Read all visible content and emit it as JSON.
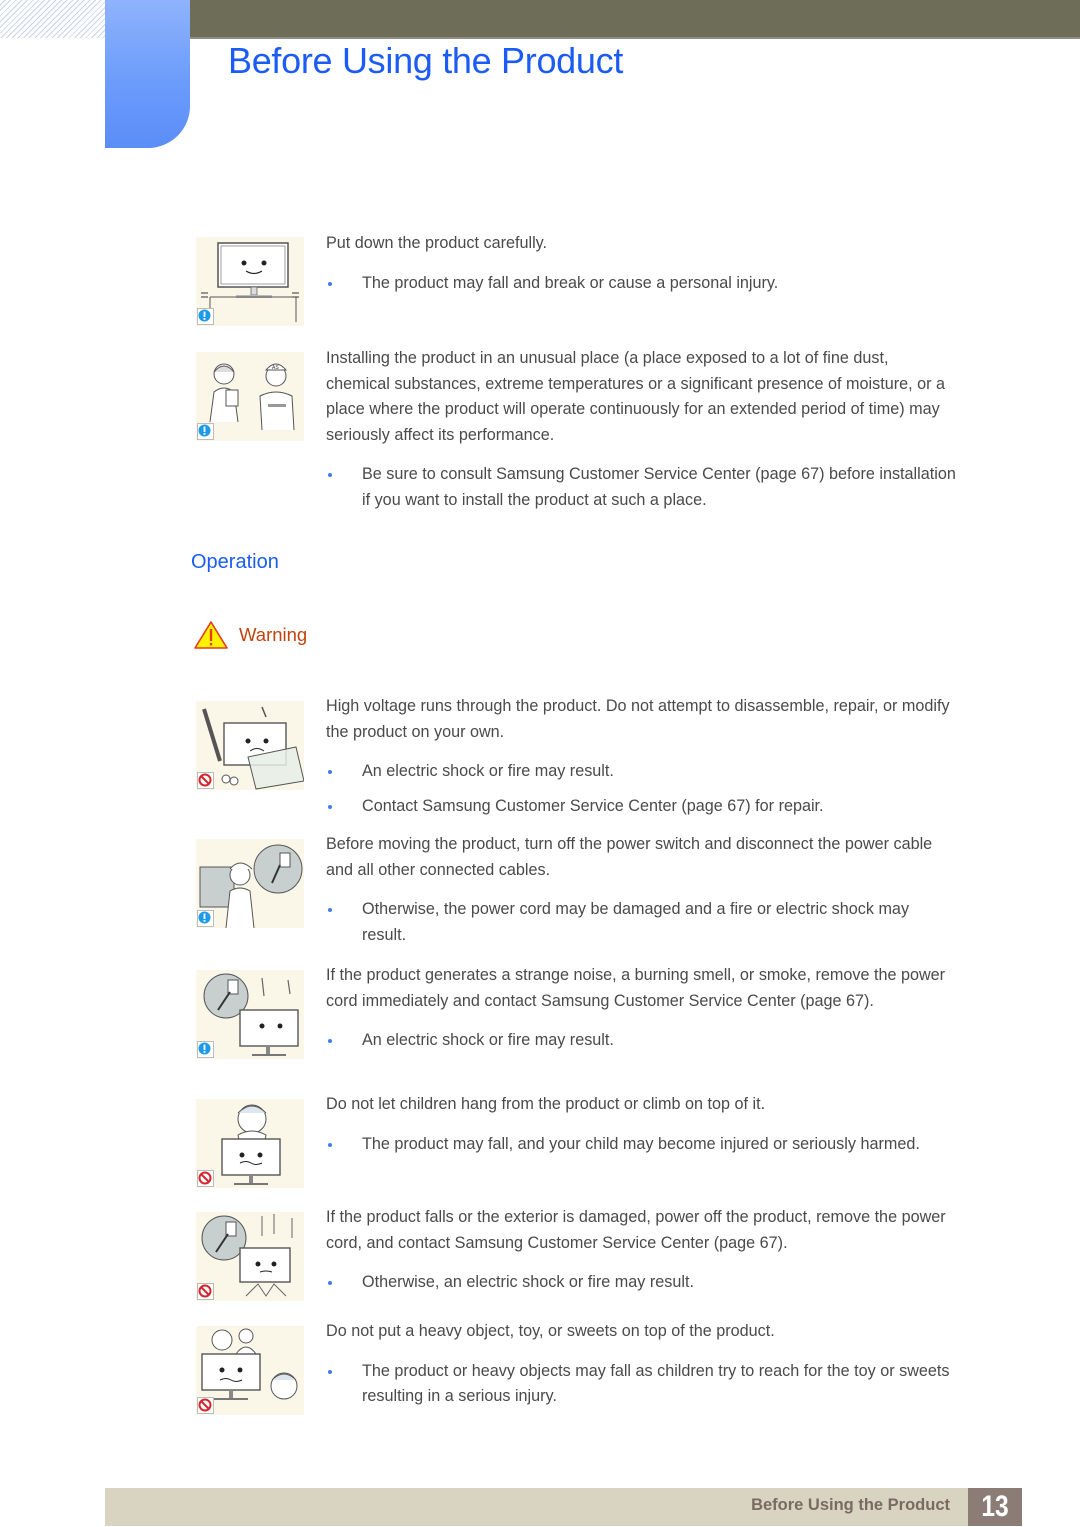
{
  "header": {
    "title": "Before Using the Product"
  },
  "intro_items": [
    {
      "badge": "caution-icon",
      "illustration": "monitor-placed-carefully",
      "text": "Put down the product carefully.",
      "bullets": [
        "The product may fall and break or cause a personal injury."
      ]
    },
    {
      "badge": "caution-icon",
      "illustration": "consult-service-center",
      "text": "Installing the product in an unusual place (a place exposed to a lot of fine dust, chemical substances, extreme temperatures or a significant presence of moisture, or a place where the product will operate continuously for an extended period of time) may seriously affect its performance.",
      "bullets": [
        "Be sure to consult Samsung Customer Service Center (page 67) before installation if you want to install the product at such a place."
      ]
    }
  ],
  "section": {
    "title": "Operation",
    "warning_label": "Warning"
  },
  "operation_items": [
    {
      "badge": "prohibited-icon",
      "illustration": "do-not-disassemble",
      "text": "High voltage runs through the product. Do not attempt to disassemble, repair, or modify the product on your own.",
      "bullets": [
        "An electric shock or fire may result.",
        "Contact Samsung Customer Service Center (page 67) for repair."
      ]
    },
    {
      "badge": "caution-icon",
      "illustration": "unplug-before-moving",
      "text": "Before moving the product, turn off the power switch and disconnect the power cable and all other connected cables.",
      "bullets": [
        "Otherwise, the power cord may be damaged and a fire or electric shock may result."
      ]
    },
    {
      "badge": "caution-icon",
      "illustration": "smoke-unplug",
      "text": "If the product generates a strange noise, a burning smell, or smoke, remove the power cord immediately and contact Samsung Customer Service Center (page 67).",
      "bullets": [
        "An electric shock or fire may result."
      ]
    },
    {
      "badge": "prohibited-icon",
      "illustration": "child-climbing",
      "text": "Do not let children hang from the product or climb on top of it.",
      "bullets": [
        "The product may fall, and your child may become injured or seriously harmed."
      ]
    },
    {
      "badge": "prohibited-icon",
      "illustration": "product-fallen",
      "text": "If the product falls or the exterior is damaged, power off the product, remove the power cord, and contact Samsung Customer Service Center (page 67).",
      "bullets": [
        "Otherwise, an electric shock or fire may result."
      ]
    },
    {
      "badge": "prohibited-icon",
      "illustration": "toys-on-top",
      "text": "Do not put a heavy object, toy, or sweets on top of the product.",
      "bullets": [
        "The product or heavy objects may fall as children try to reach for the toy or sweets resulting in a serious injury."
      ]
    }
  ],
  "footer": {
    "title": "Before Using the Product",
    "page_number": "13"
  },
  "colors": {
    "title_blue": "#1a5cf5",
    "top_bar": "#6e6d58",
    "warning_orange": "#c1440e",
    "bullet_blue": "#3f7fe6",
    "footer_bg": "#d9d3c1",
    "page_num_bg": "#8b7d75"
  }
}
